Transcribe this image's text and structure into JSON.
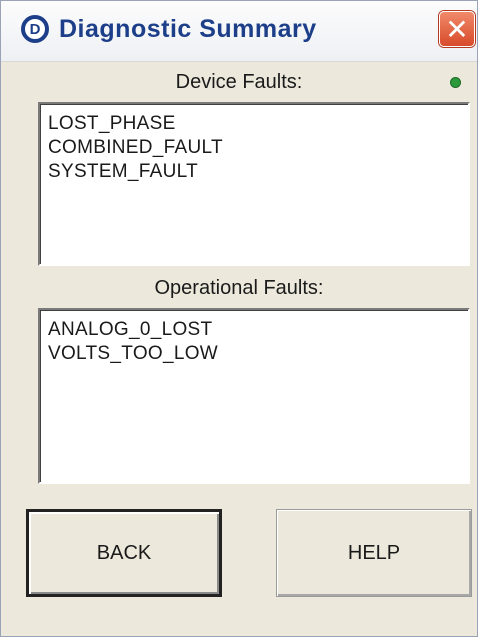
{
  "window": {
    "title": "Diagnostic Summary",
    "app_icon_glyph": "D",
    "close_glyph": "✕",
    "close_color": "#d84a2a",
    "title_color": "#1d3f8a"
  },
  "device_faults": {
    "label": "Device Faults:",
    "status_led_color": "#2c9a3a",
    "items": [
      "LOST_PHASE",
      "COMBINED_FAULT",
      "SYSTEM_FAULT"
    ]
  },
  "operational_faults": {
    "label": "Operational Faults:",
    "items": [
      "ANALOG_0_LOST",
      "VOLTS_TOO_LOW"
    ]
  },
  "buttons": {
    "back_label": "BACK",
    "help_label": "HELP"
  }
}
